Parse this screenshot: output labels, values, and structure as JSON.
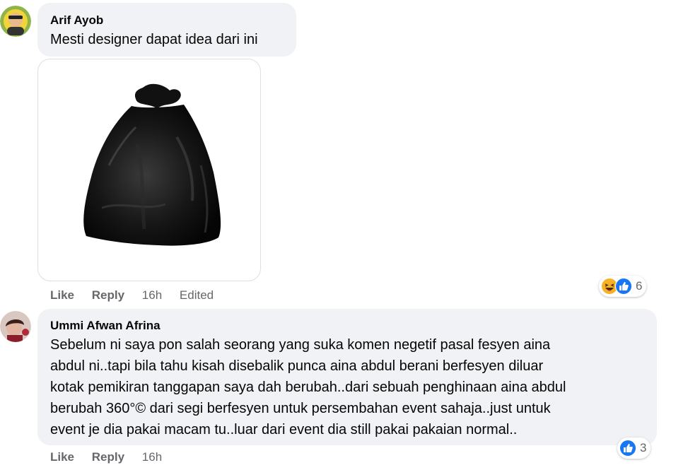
{
  "comments": [
    {
      "author": "Arif Ayob",
      "text": "Mesti designer dapat idea dari ini",
      "actions": {
        "like": "Like",
        "reply": "Reply",
        "time": "16h",
        "edited": "Edited"
      },
      "reactions": {
        "icons": [
          "haha-icon",
          "like-icon"
        ],
        "count": "6"
      },
      "image_alt": "black garbage bag"
    },
    {
      "author": "Ummi Afwan Afrina",
      "text_lines": [
        "Sebelum ni saya pon salah seorang yang suka komen negetif pasal fesyen aina",
        "abdul ni..tapi bila tahu kisah disebalik punca aina abdul berani berfesyen diluar",
        "kotak pemikiran tanggapan saya dah berubah..dari sebuah penghinaan aina abdul",
        "berubah 360°© dari segi berfesyen untuk persembahan event sahaja..just untuk",
        "event je dia pakai macam tu..luar dari event dia still pakai pakaian normal.."
      ],
      "actions": {
        "like": "Like",
        "reply": "Reply",
        "time": "16h"
      },
      "reactions": {
        "icons": [
          "like-icon"
        ],
        "count": "3"
      }
    }
  ],
  "colors": {
    "bubble": "#f0f2f5",
    "meta": "#65676b",
    "like_blue": "#1877f2",
    "haha_yellow": "#f7b125"
  }
}
